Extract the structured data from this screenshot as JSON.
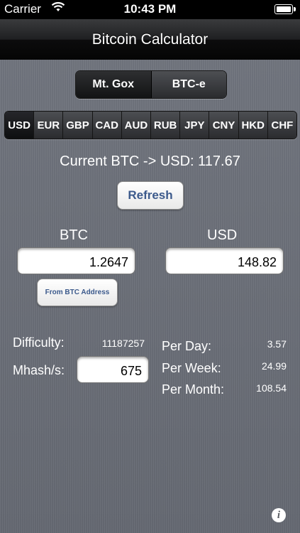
{
  "status": {
    "carrier": "Carrier",
    "time": "10:43 PM"
  },
  "nav": {
    "title": "Bitcoin Calculator"
  },
  "exchanges": [
    "Mt. Gox",
    "BTC-e"
  ],
  "currencies": [
    "USD",
    "EUR",
    "GBP",
    "CAD",
    "AUD",
    "RUB",
    "JPY",
    "CNY",
    "HKD",
    "CHF"
  ],
  "rate_text": "Current BTC -> USD: 117.67",
  "refresh_label": "Refresh",
  "converter": {
    "btc_label": "BTC",
    "usd_label": "USD",
    "btc_value": "1.2647",
    "usd_value": "148.82",
    "from_address_label": "From BTC Address"
  },
  "mining": {
    "difficulty_label": "Difficulty:",
    "difficulty_value": "11187257",
    "mhash_label": "Mhash/s:",
    "mhash_value": "675",
    "per_day_label": "Per Day:",
    "per_day_value": "3.57",
    "per_week_label": "Per Week:",
    "per_week_value": "24.99",
    "per_month_label": "Per Month:",
    "per_month_value": "108.54"
  },
  "info_glyph": "i"
}
